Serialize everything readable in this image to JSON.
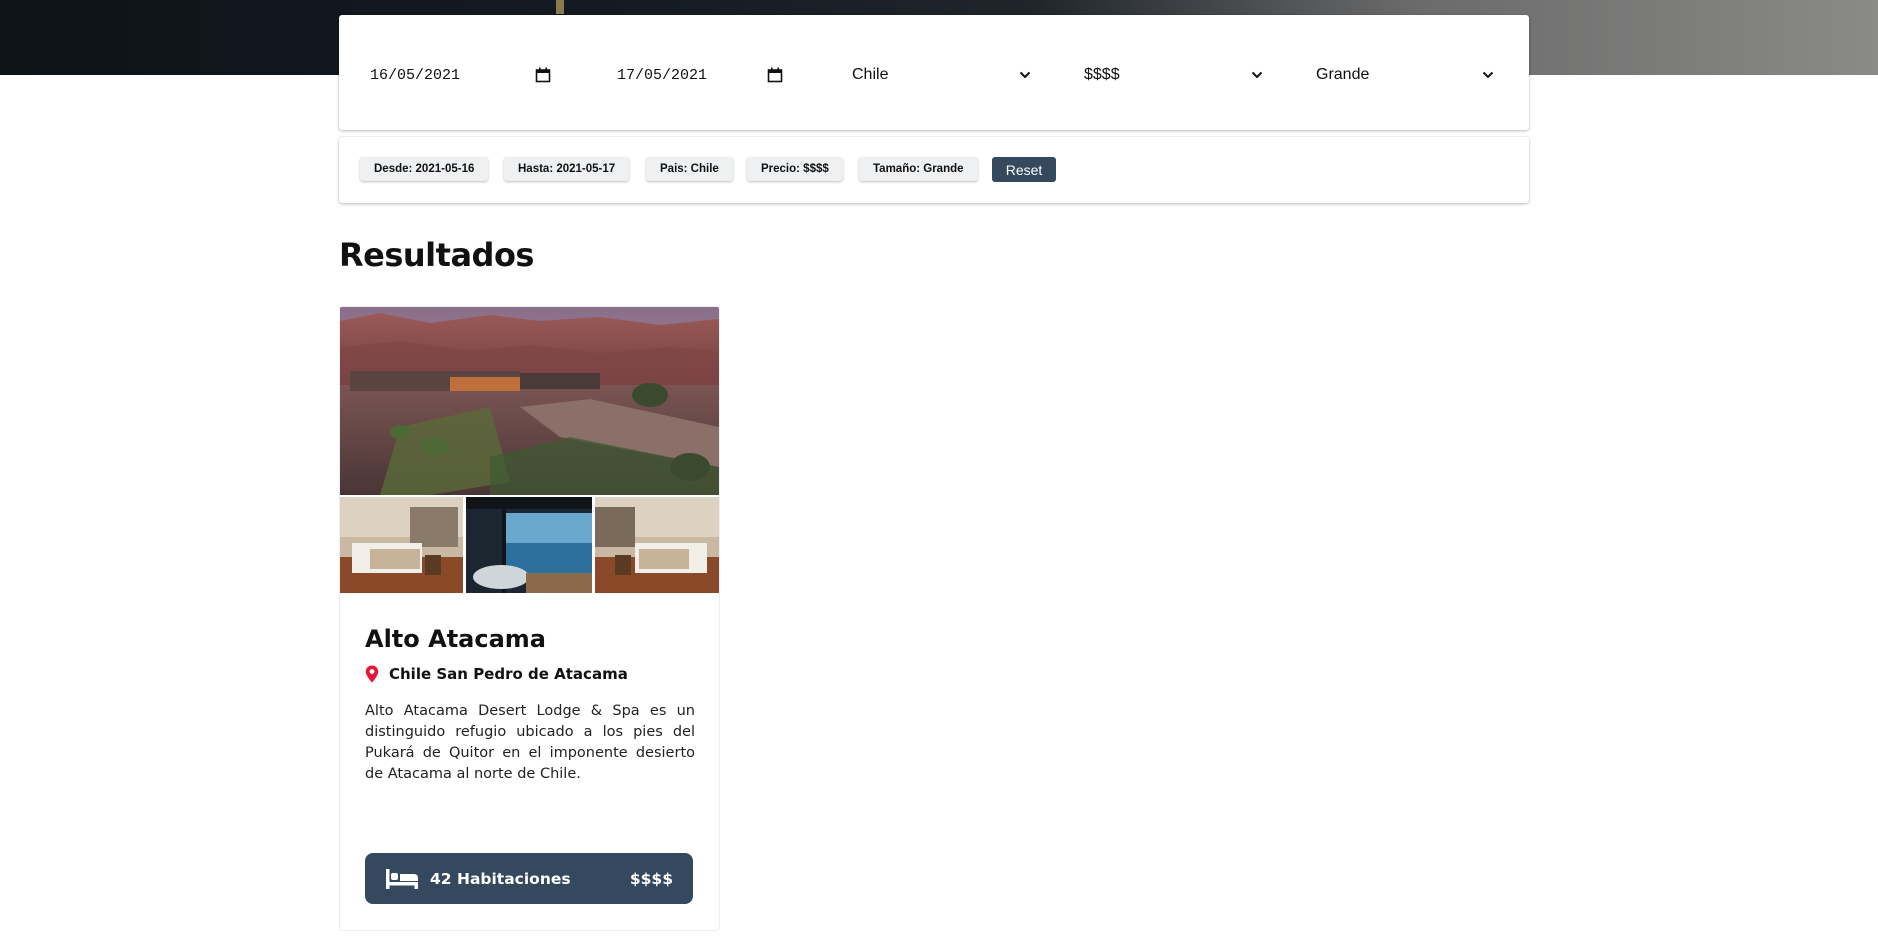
{
  "filters": {
    "date_from": "16/05/2021",
    "date_to": "17/05/2021",
    "country": "Chile",
    "price": "$$$$",
    "size": "Grande"
  },
  "chips": {
    "from": "Desde: 2021-05-16",
    "to": "Hasta: 2021-05-17",
    "country": "Pais: Chile",
    "price": "Precio: $$$$",
    "size": "Tamaño: Grande",
    "reset": "Reset"
  },
  "results": {
    "title": "Resultados",
    "hotels": [
      {
        "name": "Alto Atacama",
        "location": "Chile San Pedro de Atacama",
        "description": "Alto Atacama Desert Lodge & Spa es un distinguido refugio ubicado a los pies del Pukará de Quitor en el imponente desierto de Atacama al norte de Chile.",
        "rooms": "42 Habitaciones",
        "price": "$$$$"
      }
    ]
  },
  "colors": {
    "accent": "#34495e",
    "pin": "#e8163b"
  },
  "icons": [
    "calendar-icon",
    "chevron-down-icon",
    "location-pin-icon",
    "bed-icon"
  ]
}
